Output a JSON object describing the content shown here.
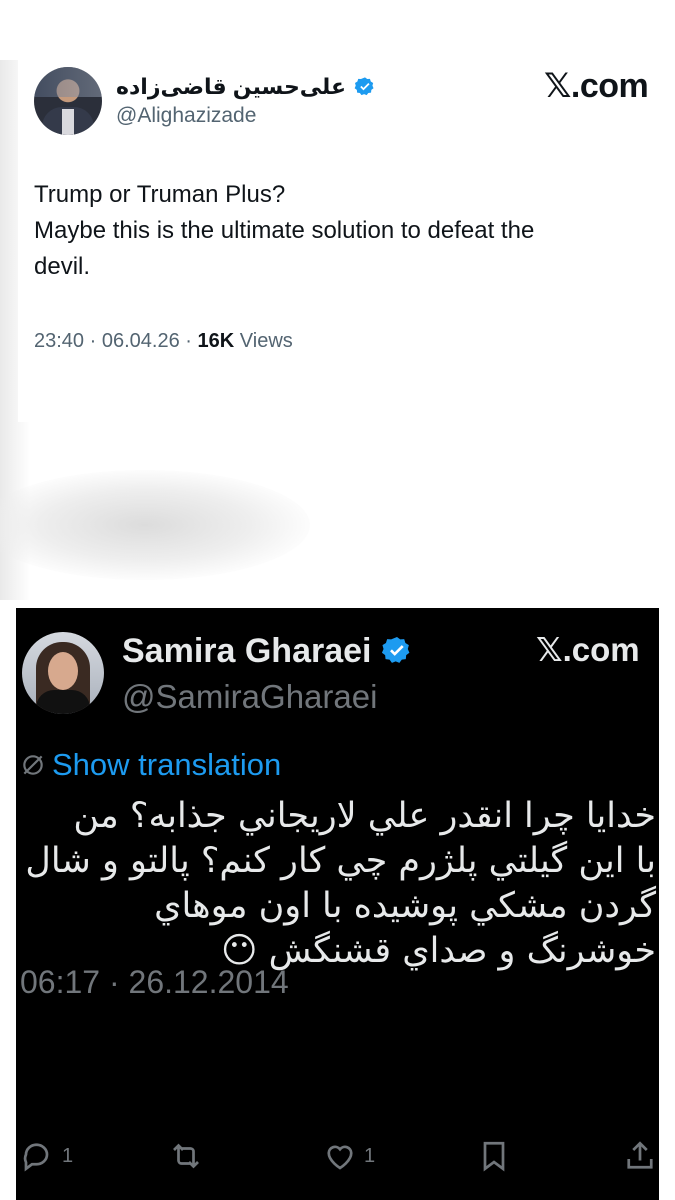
{
  "tweet_top": {
    "display_name": "علی‌حسین قاضی‌زاده",
    "handle": "@Alighazizade",
    "brand": {
      "x": "𝕏",
      "domain": ".com"
    },
    "text_lines": [
      "Trump or Truman Plus?",
      "Maybe this is the ultimate solution to defeat the",
      "devil."
    ],
    "time": "23:40",
    "sep1": "·",
    "date": "06.04.26",
    "sep2": "·",
    "views_count": "16K",
    "views_label": "Views",
    "verified_color": "#1d9bf0"
  },
  "tweet_bottom": {
    "display_name": "Samira Gharaei",
    "handle": "@SamiraGharaei",
    "brand": {
      "x": "𝕏",
      "domain": ".com"
    },
    "show_translation": "Show translation",
    "text_lines": [
      "خدایا چرا انقدر علي لاریجاني جذابه؟ من",
      "با این گیلتي پلژرم چي کار کنم؟ پالتو و شال",
      "گردن مشکي پوشیده با اون موهاي",
      "خوشرنگ و صداي قشنگش 😶"
    ],
    "timestamp": "06:17 · 26.12.2014",
    "actions": {
      "reply_count": "1",
      "retweet_count": "",
      "like_count": "1"
    },
    "icons": [
      "reply-icon",
      "retweet-icon",
      "like-icon",
      "bookmark-icon",
      "share-icon"
    ],
    "link_color": "#1d9bf0"
  }
}
